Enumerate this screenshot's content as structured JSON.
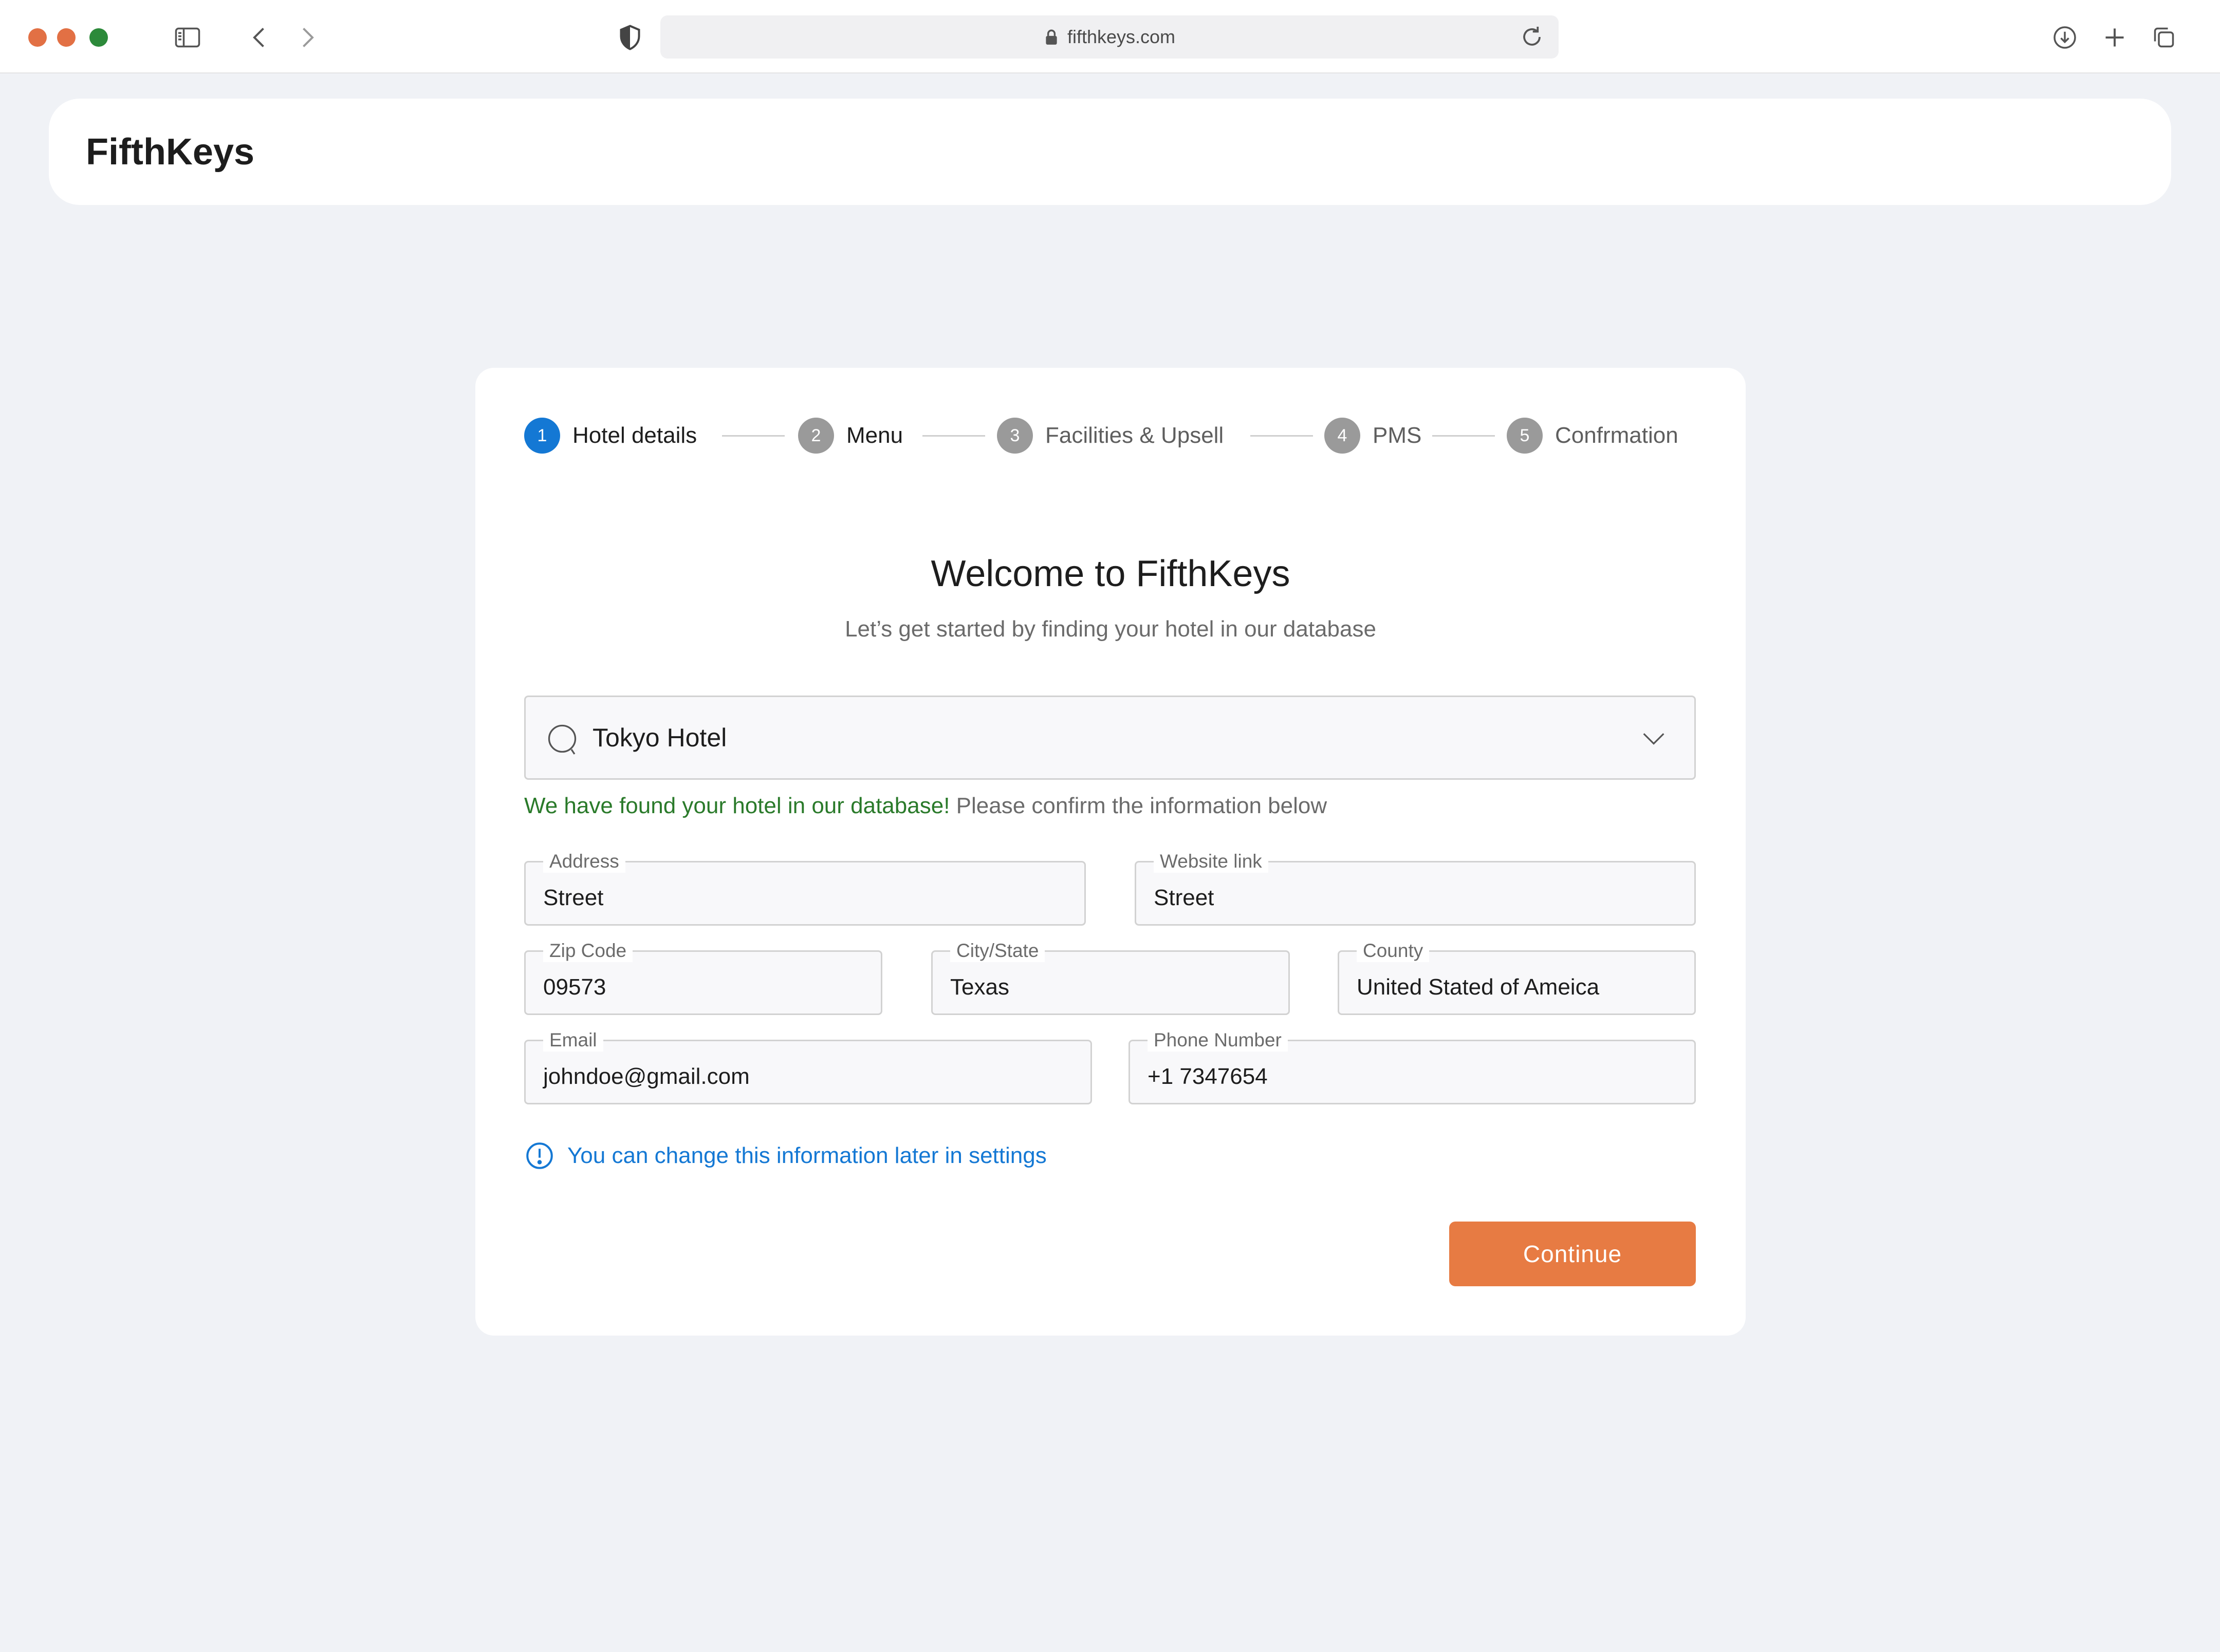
{
  "browser": {
    "url": "fifthkeys.com"
  },
  "app": {
    "logo": "FifthKeys"
  },
  "steps": [
    {
      "number": "1",
      "label": "Hotel details"
    },
    {
      "number": "2",
      "label": "Menu"
    },
    {
      "number": "3",
      "label": "Facilities & Upsell"
    },
    {
      "number": "4",
      "label": "PMS"
    },
    {
      "number": "5",
      "label": "Confrmation"
    }
  ],
  "form": {
    "title": "Welcome to FifthKeys",
    "subtitle": "Let’s get started by finding your hotel in our database",
    "search_value": "Tokyo Hotel",
    "found_message_highlight": "We have found your hotel in our database!",
    "found_message_rest": " Please confirm the information below",
    "fields": {
      "address": {
        "label": "Address",
        "value": "Street"
      },
      "website": {
        "label": "Website link",
        "value": "Street"
      },
      "zip": {
        "label": "Zip Code",
        "value": "09573"
      },
      "city": {
        "label": "City/State",
        "value": "Texas"
      },
      "county": {
        "label": "County",
        "value": "United Stated of Ameica"
      },
      "email": {
        "label": "Email",
        "value": "johndoe@gmail.com"
      },
      "phone": {
        "label": "Phone Number",
        "value": "+1 7347654"
      }
    },
    "info_message": "You can change this information later in settings",
    "continue_label": "Continue"
  },
  "colors": {
    "accent_blue": "#1478d4",
    "success_green": "#2a7a2a",
    "cta_orange": "#e77b43",
    "background": "#f0f2f6"
  }
}
